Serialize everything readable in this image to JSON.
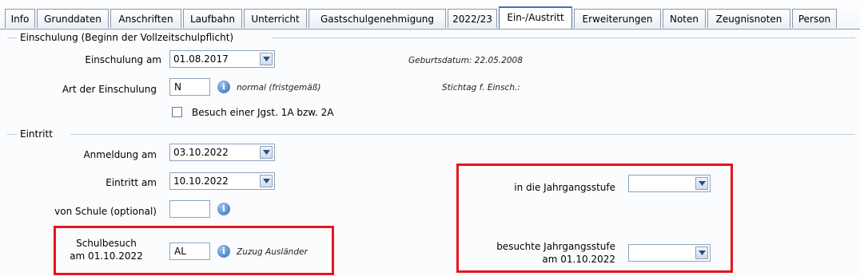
{
  "tabs": [
    {
      "label": "Info"
    },
    {
      "label": "Grunddaten"
    },
    {
      "label": "Anschriften"
    },
    {
      "label": "Laufbahn"
    },
    {
      "label": "Unterricht"
    },
    {
      "label": "Gastschulgenehmigung"
    },
    {
      "label": "2022/23"
    },
    {
      "label": "Ein-/Austritt",
      "active": true
    },
    {
      "label": "Erweiterungen"
    },
    {
      "label": "Noten"
    },
    {
      "label": "Zeugnisnoten"
    },
    {
      "label": "Person"
    }
  ],
  "einschulung": {
    "legend": "Einschulung (Beginn der Vollzeitschulpflicht)",
    "am_label": "Einschulung am",
    "am_value": "01.08.2017",
    "geburtsdatum": "Geburtsdatum: 22.05.2008",
    "art_label": "Art der Einschulung",
    "art_value": "N",
    "art_desc": "normal (fristgemäß)",
    "stichtag": "Stichtag f. Einsch.:",
    "besuch_label": "Besuch einer Jgst. 1A bzw. 2A",
    "besuch_checked": false
  },
  "eintritt": {
    "legend": "Eintritt",
    "anmeldung_label": "Anmeldung am",
    "anmeldung_value": "03.10.2022",
    "eintritt_label": "Eintritt am",
    "eintritt_value": "10.10.2022",
    "von_schule_label": "von Schule (optional)",
    "von_schule_value": "",
    "schulbesuch_label_1": "Schulbesuch",
    "schulbesuch_label_2": "am 01.10.2022",
    "schulbesuch_value": "AL",
    "schulbesuch_desc": "Zuzug Ausländer",
    "jahrgangsstufe_label": "in die Jahrgangsstufe",
    "jahrgangsstufe_value": "",
    "besuchte_label_1": "besuchte Jahrgangsstufe",
    "besuchte_label_2": "am 01.10.2022",
    "besuchte_value": ""
  },
  "icons": {
    "info": "info-icon",
    "dropdown": "chevron-down-icon"
  },
  "colors": {
    "highlight": "#e8141c",
    "active_tab": "#3d75b8",
    "info_icon": "#2f6db8"
  }
}
